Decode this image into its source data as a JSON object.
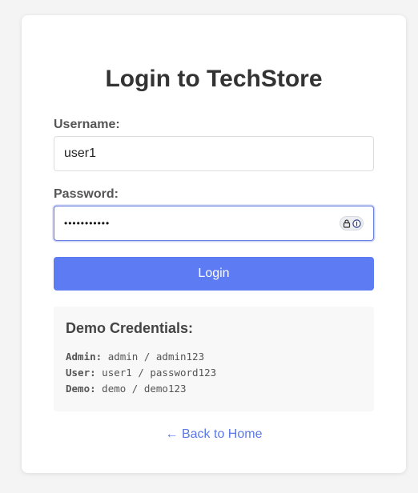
{
  "page": {
    "title": "Login to TechStore"
  },
  "form": {
    "username_label": "Username:",
    "username_value": "user1",
    "password_label": "Password:",
    "password_masked": "•••••••••••",
    "login_button": "Login"
  },
  "demo": {
    "title": "Demo Credentials:",
    "credentials": [
      {
        "role": "Admin:",
        "value": "admin / admin123"
      },
      {
        "role": "User:",
        "value": "user1 / password123"
      },
      {
        "role": "Demo:",
        "value": "demo / demo123"
      }
    ]
  },
  "footer": {
    "back_link": "← Back to Home"
  },
  "colors": {
    "accent": "#5d7bf2",
    "link": "#5a78e8",
    "focus_border": "#6a7fe0"
  },
  "icons": {
    "password_manager": "password-manager-icon"
  }
}
